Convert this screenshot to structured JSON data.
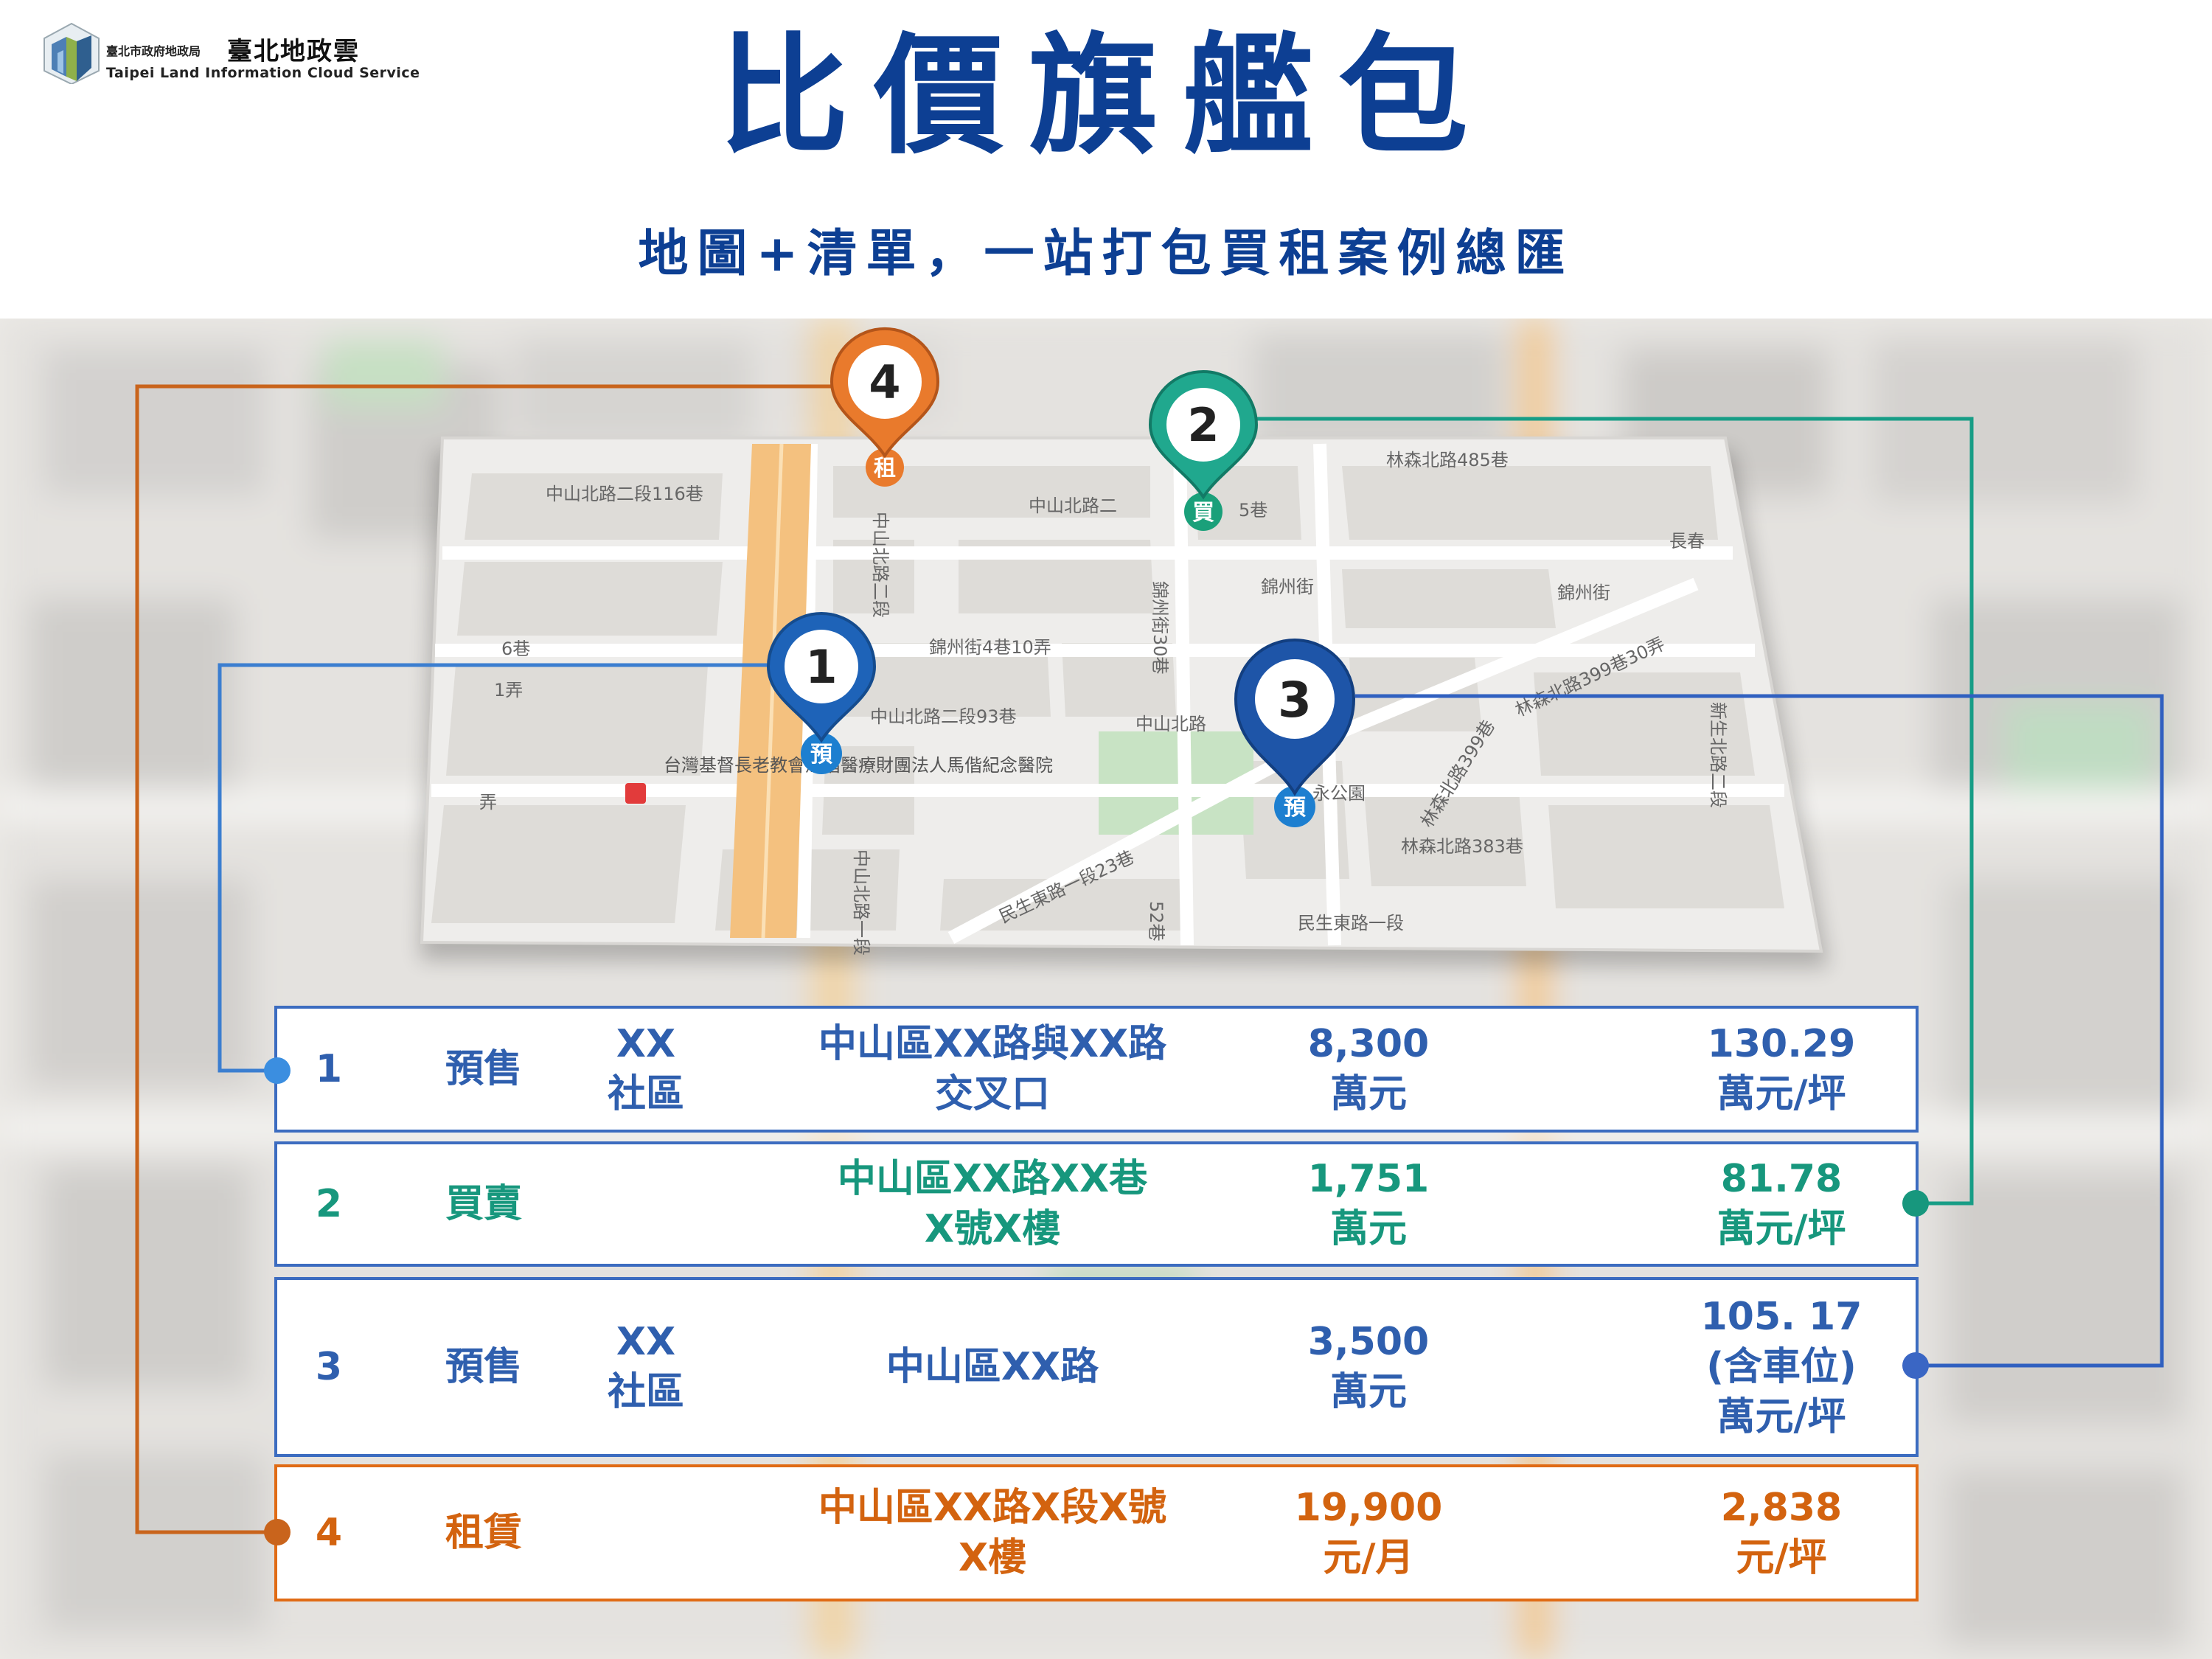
{
  "header": {
    "org_zh": "臺北市政府地政局",
    "brand_zh": "臺北地政雲",
    "brand_en": "Taipei Land Information Cloud Service",
    "title": "比價旗艦包",
    "subtitle": "地圖+清單，一站打包買租案例總匯"
  },
  "colors": {
    "title_blue": "#0d3f93",
    "row_blue": "#2f5fae",
    "pin_blue": "#1f5fae",
    "green": "#17977d",
    "orange": "#e06b15"
  },
  "map": {
    "labels": [
      "中山北路二段116巷",
      "中山北路二",
      "5巷",
      "林森北路485巷",
      "錦州街",
      "錦州街4巷10弄",
      "錦州街30巷",
      "6巷",
      "1弄",
      "中山北路二段93巷",
      "台灣基督長老教會馬偕醫療財團法人馬偕紀念醫院",
      "中山北路",
      "永公園",
      "民生東路一段23巷",
      "林森北路383巷",
      "林森北路399巷30弄",
      "林森北路399巷",
      "民生東路一段",
      "52巷",
      "新生北路二段",
      "錦州街",
      "中山北路一段",
      "中山北路二段",
      "長春",
      "弄"
    ],
    "pins": [
      {
        "num": "1",
        "badge": "預",
        "color_key": "pin_blue"
      },
      {
        "num": "2",
        "badge": "買",
        "color_key": "green"
      },
      {
        "num": "3",
        "badge": "預",
        "color_key": "pin_blue"
      },
      {
        "num": "4",
        "badge": "租",
        "color_key": "orange"
      }
    ]
  },
  "rows": [
    {
      "idx": "1",
      "type": "預售",
      "community": [
        "XX",
        "社區"
      ],
      "address": [
        "中山區XX路與XX路",
        "交叉口"
      ],
      "price": [
        "8,300",
        "萬元"
      ],
      "unit_price": [
        "130.29",
        "萬元/坪"
      ]
    },
    {
      "idx": "2",
      "type": "買賣",
      "address": [
        "中山區XX路XX巷",
        "X號X樓"
      ],
      "price": [
        "1,751",
        "萬元"
      ],
      "unit_price": [
        "81.78",
        "萬元/坪"
      ]
    },
    {
      "idx": "3",
      "type": "預售",
      "community": [
        "XX",
        "社區"
      ],
      "address": [
        "中山區XX路"
      ],
      "price": [
        "3,500",
        "萬元"
      ],
      "unit_price": [
        "105. 17",
        "(含車位)",
        "萬元/坪"
      ]
    },
    {
      "idx": "4",
      "type": "租賃",
      "address": [
        "中山區XX路X段X號",
        "X樓"
      ],
      "price": [
        "19,900",
        "元/月"
      ],
      "unit_price": [
        "2,838",
        "元/坪"
      ]
    }
  ]
}
